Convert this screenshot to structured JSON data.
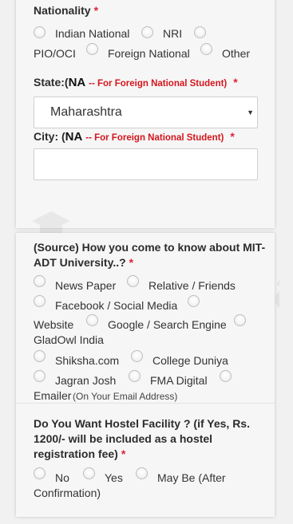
{
  "nationality": {
    "label": "Nationality",
    "required": "*",
    "options": [
      "Indian National",
      "NRI",
      "PIO/OCI",
      "Foreign National",
      "Other"
    ]
  },
  "state": {
    "label": "State:",
    "paren_open": "(",
    "na": "NA",
    "note": "-- For Foreign National Student)",
    "required": "*",
    "selected": "Maharashtra"
  },
  "city": {
    "label": "City: ",
    "paren_open": "(",
    "na": "NA",
    "note": "-- For Foreign National Student)",
    "required": "*",
    "value": ""
  },
  "source": {
    "label_line1": "(Source) How you come to know about MIT-",
    "label_line2": "ADT University..?",
    "required": "*",
    "options": [
      "News Paper",
      "Relative / Friends",
      "Facebook / Social Media",
      "Website",
      "Google / Search Engine",
      "GladOwl India",
      "Shiksha.com",
      "College Duniya",
      "Jagran Josh",
      "FMA Digital",
      "Emailer"
    ],
    "emailer_note": "(On Your Email Address)"
  },
  "hostel": {
    "label_line1": "Do You Want Hostel Facility ? (if Yes, Rs.",
    "label_line2": "1200/- will be included as a hostel",
    "label_line3": "registration fee)",
    "required": "*",
    "options": [
      "No",
      "Yes",
      "May Be (After",
      "Confirmation)"
    ]
  },
  "watermark": {
    "text": "shiksha",
    "icon": "graduation-cap-icon"
  },
  "colors": {
    "required": "#e0203a",
    "note": "#d4161e",
    "card_bg": "#f6f6f6",
    "page_bg": "#f1f1f1"
  }
}
